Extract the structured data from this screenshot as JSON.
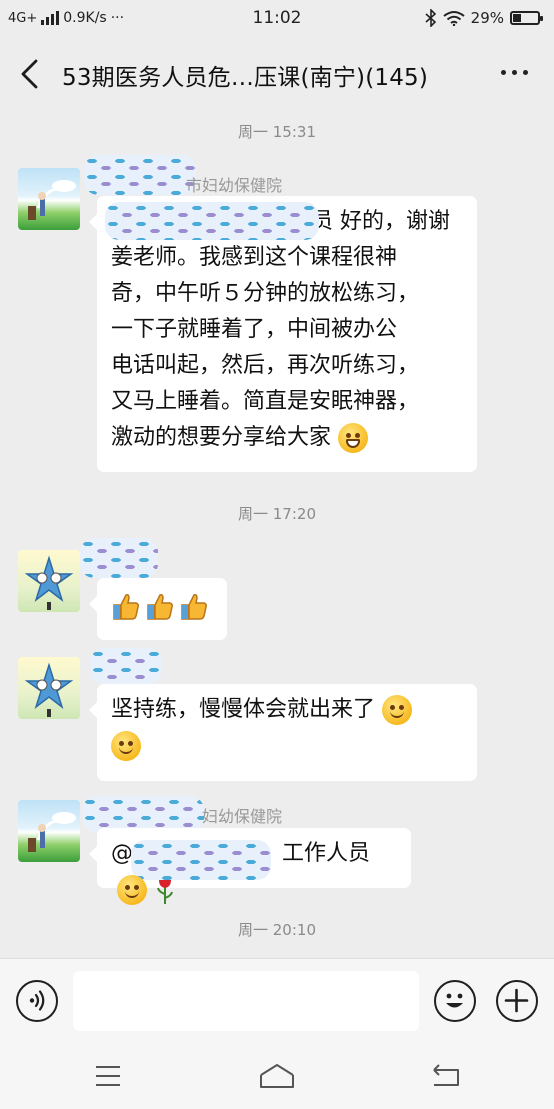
{
  "status_bar": {
    "network": "4G+",
    "speed": "0.9K/s",
    "extra": "···",
    "time": "11:02",
    "battery": "29%",
    "battery_level": 0.29,
    "icons": [
      "signal-icon",
      "bluetooth-icon",
      "wifi-icon",
      "battery-icon"
    ]
  },
  "header": {
    "title": "53期医务人员危…压课(南宁)(145)",
    "back_icon": "chevron-left-icon",
    "more_icon": "more-dots-icon"
  },
  "messages": [
    {
      "time": "周一 15:31",
      "sender_visible": "市妇幼保健院",
      "text_lines": [
        "员 好的，谢谢",
        "姜老师。我感到这个课程很神",
        "奇，中午听５分钟的放松练习，",
        "一下子就睡着了，中间被办公",
        "电话叫起，然后，再次听练习，",
        "又马上睡着。简直是安眠神器，",
        "激动的想要分享给大家"
      ],
      "emoji": "grin-icon"
    },
    {
      "time": "周一 17:20",
      "emoji_count": 3,
      "emoji": "thumbs-up-icon"
    },
    {
      "text_lines": [
        "坚持练，慢慢体会就出来了",
        ""
      ],
      "emoji": "smile-icon"
    },
    {
      "sender_visible": "妇幼保健院",
      "prefix": "@",
      "text": "工作人员",
      "emoji": [
        "smile-icon",
        "rose-icon"
      ]
    },
    {
      "time": "周一 20:10"
    }
  ],
  "input_bar": {
    "value": "",
    "placeholder": "",
    "icons": [
      "voice-icon",
      "emoji-icon",
      "plus-icon"
    ]
  },
  "nav_bar": {
    "icons": [
      "menu-icon",
      "home-icon",
      "back-icon"
    ]
  },
  "colors": {
    "background": "#ededed",
    "bubble": "#ffffff",
    "time_text": "#8a8a8a",
    "redaction_blue": "#4aaad8",
    "redaction_purple": "#9a8ed0"
  }
}
